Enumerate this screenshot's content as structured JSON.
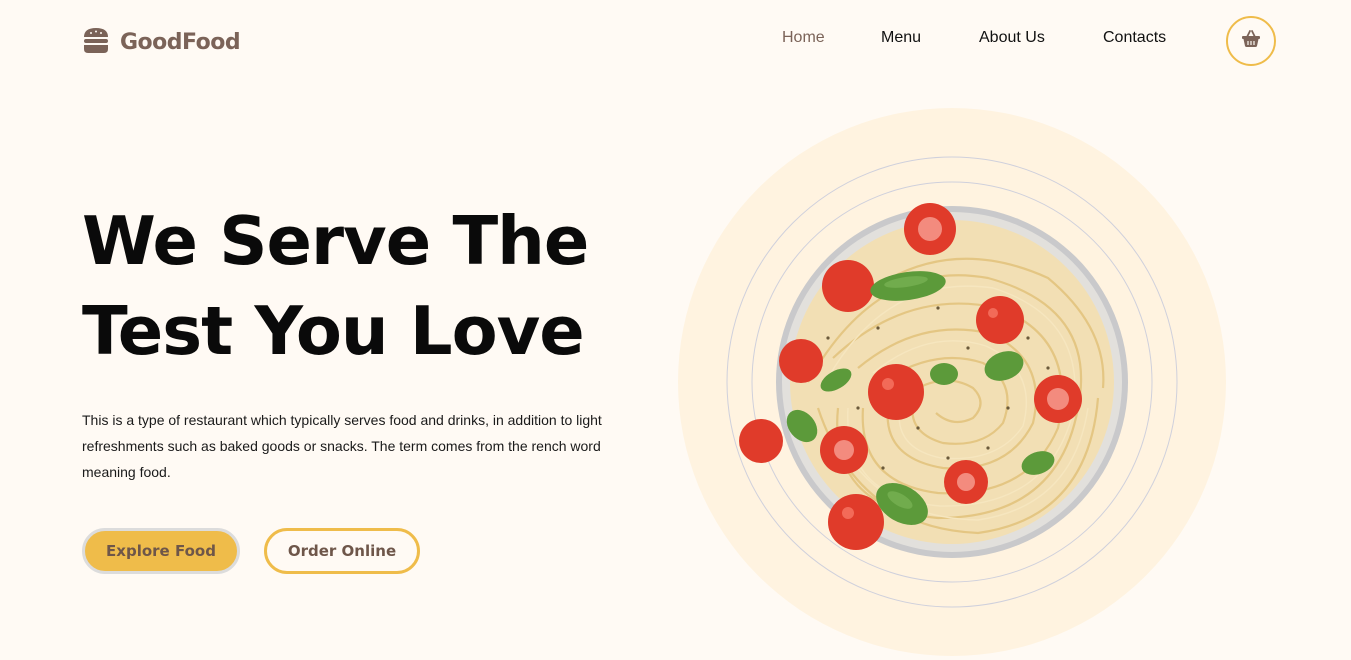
{
  "brand": {
    "name": "GoodFood",
    "icon": "burger-icon"
  },
  "nav": {
    "items": [
      {
        "label": "Home",
        "active": true
      },
      {
        "label": "Menu",
        "active": false
      },
      {
        "label": "About Us",
        "active": false
      },
      {
        "label": "Contacts",
        "active": false
      }
    ],
    "cart_icon": "basket-icon"
  },
  "hero": {
    "title_line1": "We Serve The",
    "title_line2": "Test You Love",
    "description": "This is a type of restaurant which typically serves food and drinks, in addition to light refreshments such as baked goods or snacks. The term comes from the rench word meaning food.",
    "primary_button": "Explore Food",
    "secondary_button": "Order Online",
    "image": "spaghetti-bowl-image"
  },
  "colors": {
    "background": "#fffaf4",
    "accent": "#efbc4a",
    "brand": "#7b6358",
    "text": "#0a0a0a",
    "circle": "#fff3e0"
  }
}
